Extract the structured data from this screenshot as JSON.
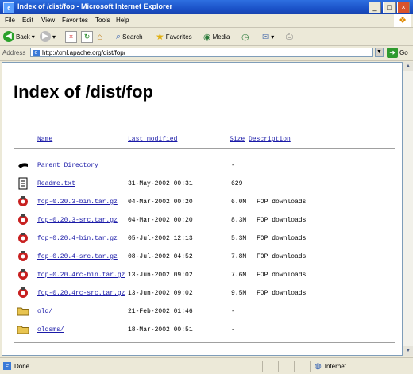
{
  "window": {
    "title": "Index of /dist/fop - Microsoft Internet Explorer"
  },
  "menu": [
    "File",
    "Edit",
    "View",
    "Favorites",
    "Tools",
    "Help"
  ],
  "toolbar": {
    "back": "Back",
    "search": "Search",
    "favorites": "Favorites",
    "media": "Media"
  },
  "address": {
    "label": "Address",
    "url": "http://xml.apache.org/dist/fop/",
    "go": "Go"
  },
  "page": {
    "heading": "Index of /dist/fop",
    "columns": {
      "name": "Name",
      "modified": "Last modified",
      "size": "Size",
      "description": "Description"
    },
    "rows": [
      {
        "icon": "back-icon",
        "name": "Parent Directory",
        "modified": "",
        "size": "-",
        "description": ""
      },
      {
        "icon": "text-file-icon",
        "name": "Readme.txt",
        "modified": "31-May-2002 00:31",
        "size": "629",
        "description": ""
      },
      {
        "icon": "archive-icon",
        "name": "fop-0.20.3-bin.tar.gz",
        "modified": "04-Mar-2002 00:20",
        "size": "6.0M",
        "description": "FOP downloads"
      },
      {
        "icon": "archive-icon",
        "name": "fop-0.20.3-src.tar.gz",
        "modified": "04-Mar-2002 00:20",
        "size": "8.3M",
        "description": "FOP downloads"
      },
      {
        "icon": "archive-icon",
        "name": "fop-0.20.4-bin.tar.gz",
        "modified": "05-Jul-2002 12:13",
        "size": "5.3M",
        "description": "FOP downloads"
      },
      {
        "icon": "archive-icon",
        "name": "fop-0.20.4-src.tar.gz",
        "modified": "08-Jul-2002 04:52",
        "size": "7.8M",
        "description": "FOP downloads"
      },
      {
        "icon": "archive-icon",
        "name": "fop-0.20.4rc-bin.tar.gz",
        "modified": "13-Jun-2002 09:02",
        "size": "7.6M",
        "description": "FOP downloads"
      },
      {
        "icon": "archive-icon",
        "name": "fop-0.20.4rc-src.tar.gz",
        "modified": "13-Jun-2002 09:02",
        "size": "9.5M",
        "description": "FOP downloads"
      },
      {
        "icon": "folder-icon",
        "name": "old/",
        "modified": "21-Feb-2002 01:46",
        "size": "-",
        "description": ""
      },
      {
        "icon": "folder-icon",
        "name": "oldsms/",
        "modified": "18-Mar-2002 00:51",
        "size": "-",
        "description": ""
      }
    ]
  },
  "status": {
    "text": "Done",
    "zone": "Internet"
  },
  "colors": {
    "titlebar": "#1b52c8",
    "link": "#1a1aa8",
    "chrome": "#ece9d8"
  }
}
